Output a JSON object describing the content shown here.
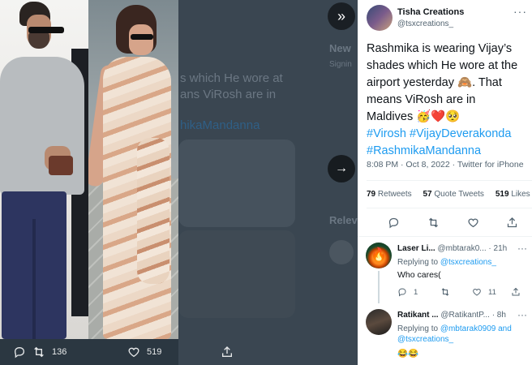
{
  "viewer": {
    "background_texts": [
      "New",
      "Signin",
      "s which He wore at",
      "ans ViRosh are in",
      "hikaMandanna",
      "Relev"
    ],
    "footer": {
      "reply_count": "",
      "retweet_count": "136",
      "like_count": "519"
    },
    "expand_icon": "double-chevron-right-icon",
    "next_icon": "arrow-right-icon"
  },
  "tweet": {
    "author_name": "Tisha Creations",
    "author_handle": "@tsxcreations_",
    "text_lines": [
      "Rashmika is wearing Vijay’s",
      "shades which He wore at the",
      "airport yesterday 🙈. That",
      "means ViRosh are in",
      "Maldives 🥳❤️🥺"
    ],
    "hashtags_line1": [
      "#Virosh",
      "#VijayDeverakonda"
    ],
    "hashtags_line2": [
      "#RashmikaMandanna"
    ],
    "timestamp": "8:08 PM · Oct 8, 2022 · Twitter for iPhone",
    "retweets_count": "79",
    "retweets_label": "Retweets",
    "quotes_count": "57",
    "quotes_label": "Quote Tweets",
    "likes_count": "519",
    "likes_label": "Likes",
    "more_icon": "more-horizontal-icon"
  },
  "replies": [
    {
      "name": "Laser Li...",
      "handle": "@mbtarak0...",
      "time": "· 21h",
      "replying_prefix": "Replying to",
      "replying_to": "@tsxcreations_",
      "text": "Who cares(",
      "reply_count": "1",
      "like_count": "11"
    },
    {
      "name": "Ratikant ...",
      "handle": "@RatikantP...",
      "time": "· 8h",
      "replying_prefix": "Replying to",
      "replying_to_line1": "@mbtarak0909 and",
      "replying_to_line2": "@tsxcreations_",
      "text": "😂😂"
    }
  ],
  "colors": {
    "accent": "#1d9bf0",
    "text_primary": "#0f1419",
    "text_secondary": "#536471",
    "viewer_bg": "#2b3741"
  }
}
